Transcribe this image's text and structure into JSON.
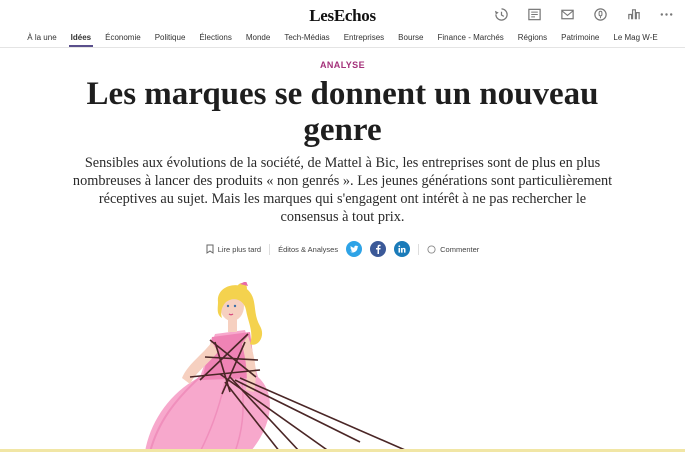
{
  "brand": {
    "logo": "LesEchos"
  },
  "toolbar": {
    "icons": [
      "history-icon",
      "newspaper-icon",
      "newsletter-icon",
      "podcast-icon",
      "stats-icon",
      "more-icon"
    ]
  },
  "nav": {
    "items": [
      "À la une",
      "Idées",
      "Économie",
      "Politique",
      "Élections",
      "Monde",
      "Tech-Médias",
      "Entreprises",
      "Bourse",
      "Finance - Marchés",
      "Régions",
      "Patrimoine",
      "Le Mag W-E"
    ],
    "active": "Idées"
  },
  "article": {
    "rubric": "ANALYSE",
    "title": "Les marques se donnent un nouveau genre",
    "lede": "Sensibles aux évolutions de la société, de Mattel à Bic, les entreprises sont de plus en plus nombreuses à lancer des produits « non genrés ». Les jeunes générations sont particulièrement réceptives au sujet. Mais les marques qui s'engagent ont intérêt à ne pas rechercher le consensus à tout prix.",
    "actions": {
      "read_later": "Lire plus tard",
      "section": "Éditos & Analyses",
      "comment": "Commenter"
    },
    "illustration": {
      "alt": "doll-in-pink-dress-tied-with-strings"
    }
  },
  "colors": {
    "rubric": "#a4317a",
    "nav_active_underline": "#5a4f8c",
    "twitter": "#2ea3e6",
    "facebook": "#3b5998",
    "linkedin": "#1a7bb9",
    "dress": "#f7a8cc",
    "hair": "#f4d24e"
  }
}
